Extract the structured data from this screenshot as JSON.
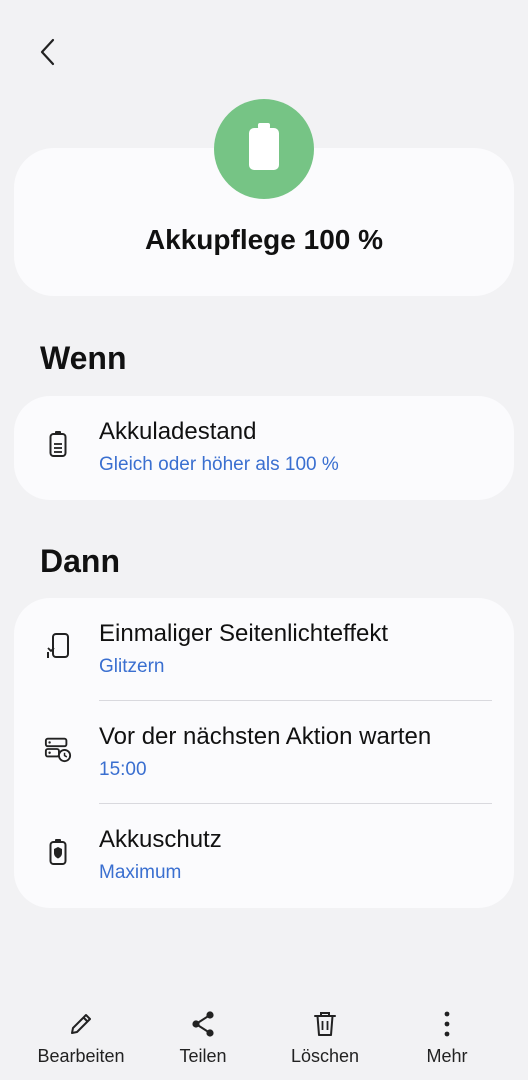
{
  "header": {
    "title": "Akkupflege 100 %",
    "icon": "battery-icon",
    "icon_bg_color": "#76c485"
  },
  "sections": {
    "when": {
      "heading": "Wenn",
      "items": [
        {
          "label": "Akkuladestand",
          "value": "Gleich oder höher als 100 %",
          "icon": "battery-level-icon"
        }
      ]
    },
    "then": {
      "heading": "Dann",
      "items": [
        {
          "label": "Einmaliger Seitenlichteffekt",
          "value": "Glitzern",
          "icon": "edge-lighting-icon"
        },
        {
          "label": "Vor der nächsten Aktion warten",
          "value": "15:00",
          "icon": "wait-timer-icon"
        },
        {
          "label": "Akkuschutz",
          "value": "Maximum",
          "icon": "battery-protection-icon"
        }
      ]
    }
  },
  "bottom_bar": {
    "edit": "Bearbeiten",
    "share": "Teilen",
    "delete": "Löschen",
    "more": "Mehr"
  },
  "colors": {
    "accent": "#3a6fd0",
    "background": "#f2f2f4",
    "card": "#fbfbfd"
  }
}
